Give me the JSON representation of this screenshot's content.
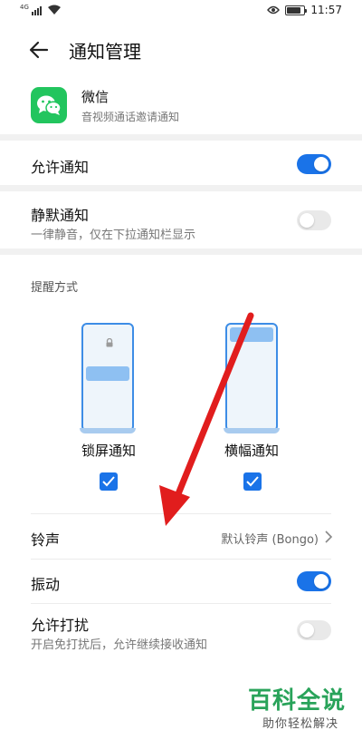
{
  "status_bar": {
    "network": "4G",
    "time": "11:57",
    "battery_level": 0.85
  },
  "header": {
    "title": "通知管理"
  },
  "app": {
    "name": "微信",
    "description": "音视频通话邀请通知",
    "icon": "wechat-icon",
    "icon_color": "#22c55e"
  },
  "settings": {
    "allow_notifications": {
      "label": "允许通知",
      "enabled": true
    },
    "silent_notifications": {
      "label": "静默通知",
      "sub": "一律静音，仅在下拉通知栏显示",
      "enabled": false
    }
  },
  "reminder": {
    "section_label": "提醒方式",
    "options": [
      {
        "label": "锁屏通知",
        "checked": true
      },
      {
        "label": "横幅通知",
        "checked": true
      }
    ]
  },
  "ringtone": {
    "label": "铃声",
    "value": "默认铃声 (Bongo)"
  },
  "vibration": {
    "label": "振动",
    "enabled": true
  },
  "do_not_disturb": {
    "label": "允许打扰",
    "sub": "开启免打扰后，允许继续接收通知",
    "enabled": false
  },
  "watermark": {
    "title": "百科全说",
    "subtitle": "助你轻松解决"
  },
  "colors": {
    "accent": "#1a73e8",
    "annotation_arrow": "#e11d1d",
    "watermark_green": "#29a35a"
  }
}
